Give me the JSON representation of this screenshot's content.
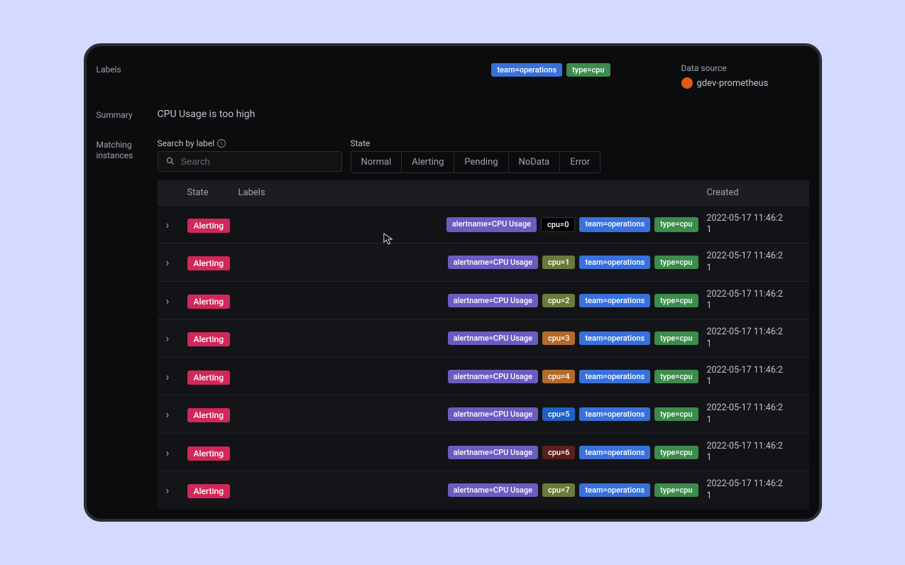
{
  "sideLabels": {
    "labels": "Labels",
    "summary": "Summary",
    "matching": "Matching instances"
  },
  "topBadges": [
    {
      "text": "team=operations",
      "cls": "b-blue"
    },
    {
      "text": "type=cpu",
      "cls": "b-green"
    }
  ],
  "dataSource": {
    "title": "Data source",
    "name": "gdev-prometheus"
  },
  "summary": "CPU Usage is too high",
  "filters": {
    "searchLabel": "Search by label",
    "searchPlaceholder": "Search",
    "stateLabel": "State",
    "states": [
      "Normal",
      "Alerting",
      "Pending",
      "NoData",
      "Error"
    ]
  },
  "table": {
    "headers": {
      "state": "State",
      "labels": "Labels",
      "created": "Created"
    },
    "rows": [
      {
        "state": "Alerting",
        "labels": [
          {
            "text": "alertname=CPU Usage",
            "cls": "b-purple"
          },
          {
            "text": "cpu=0",
            "cls": "b-black"
          },
          {
            "text": "team=operations",
            "cls": "b-blue"
          },
          {
            "text": "type=cpu",
            "cls": "b-green"
          }
        ],
        "created": "2022-05-17 11:46:21"
      },
      {
        "state": "Alerting",
        "labels": [
          {
            "text": "alertname=CPU Usage",
            "cls": "b-purple"
          },
          {
            "text": "cpu=1",
            "cls": "b-olive"
          },
          {
            "text": "team=operations",
            "cls": "b-blue"
          },
          {
            "text": "type=cpu",
            "cls": "b-green"
          }
        ],
        "created": "2022-05-17 11:46:21"
      },
      {
        "state": "Alerting",
        "labels": [
          {
            "text": "alertname=CPU Usage",
            "cls": "b-purple"
          },
          {
            "text": "cpu=2",
            "cls": "b-olive"
          },
          {
            "text": "team=operations",
            "cls": "b-blue"
          },
          {
            "text": "type=cpu",
            "cls": "b-green"
          }
        ],
        "created": "2022-05-17 11:46:21"
      },
      {
        "state": "Alerting",
        "labels": [
          {
            "text": "alertname=CPU Usage",
            "cls": "b-purple"
          },
          {
            "text": "cpu=3",
            "cls": "b-brown"
          },
          {
            "text": "team=operations",
            "cls": "b-blue"
          },
          {
            "text": "type=cpu",
            "cls": "b-green"
          }
        ],
        "created": "2022-05-17 11:46:21"
      },
      {
        "state": "Alerting",
        "labels": [
          {
            "text": "alertname=CPU Usage",
            "cls": "b-purple"
          },
          {
            "text": "cpu=4",
            "cls": "b-brown"
          },
          {
            "text": "team=operations",
            "cls": "b-blue"
          },
          {
            "text": "type=cpu",
            "cls": "b-green"
          }
        ],
        "created": "2022-05-17 11:46:21"
      },
      {
        "state": "Alerting",
        "labels": [
          {
            "text": "alertname=CPU Usage",
            "cls": "b-purple"
          },
          {
            "text": "cpu=5",
            "cls": "b-blue2"
          },
          {
            "text": "team=operations",
            "cls": "b-blue"
          },
          {
            "text": "type=cpu",
            "cls": "b-green"
          }
        ],
        "created": "2022-05-17 11:46:21"
      },
      {
        "state": "Alerting",
        "labels": [
          {
            "text": "alertname=CPU Usage",
            "cls": "b-purple"
          },
          {
            "text": "cpu=6",
            "cls": "b-maroon"
          },
          {
            "text": "team=operations",
            "cls": "b-blue"
          },
          {
            "text": "type=cpu",
            "cls": "b-green"
          }
        ],
        "created": "2022-05-17 11:46:21"
      },
      {
        "state": "Alerting",
        "labels": [
          {
            "text": "alertname=CPU Usage",
            "cls": "b-purple"
          },
          {
            "text": "cpu=7",
            "cls": "b-olive"
          },
          {
            "text": "team=operations",
            "cls": "b-blue"
          },
          {
            "text": "type=cpu",
            "cls": "b-green"
          }
        ],
        "created": "2022-05-17 11:46:21"
      }
    ]
  }
}
